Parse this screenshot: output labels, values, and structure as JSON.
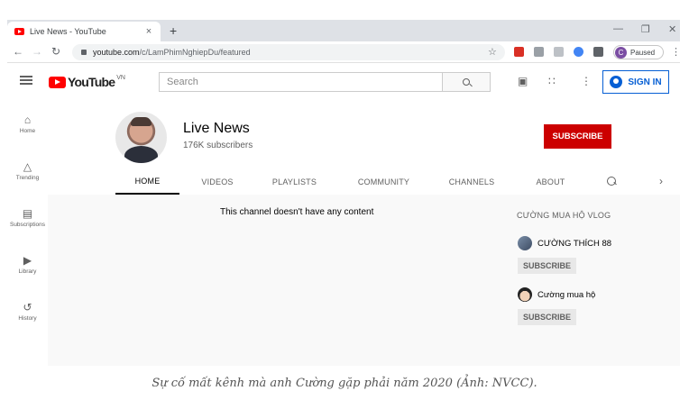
{
  "browser": {
    "tab_title": "Live News - YouTube",
    "tab_close": "×",
    "new_tab": "+",
    "url_host": "youtube.com",
    "url_path": "/c/LamPhimNghiepDu/featured",
    "profile_initial": "C",
    "profile_status": "Paused"
  },
  "header": {
    "logo_text": "YouTube",
    "logo_country": "VN",
    "search_placeholder": "Search",
    "signin_label": "SIGN IN"
  },
  "guide": {
    "items": [
      {
        "label": "Home",
        "icon": "home-icon"
      },
      {
        "label": "Trending",
        "icon": "flame-icon"
      },
      {
        "label": "Subscriptions",
        "icon": "subscriptions-icon"
      },
      {
        "label": "Library",
        "icon": "library-icon"
      },
      {
        "label": "History",
        "icon": "history-icon"
      }
    ]
  },
  "channel": {
    "name": "Live News",
    "subscribers": "176K subscribers",
    "subscribe_label": "SUBSCRIBE",
    "tabs": [
      {
        "label": "HOME"
      },
      {
        "label": "VIDEOS"
      },
      {
        "label": "PLAYLISTS"
      },
      {
        "label": "COMMUNITY"
      },
      {
        "label": "CHANNELS"
      },
      {
        "label": "ABOUT"
      }
    ]
  },
  "content": {
    "empty_message": "This channel doesn't have any content"
  },
  "sidebar": {
    "title": "CƯỜNG MUA HỘ VLOG",
    "channels": [
      {
        "name": "CƯỜNG THÍCH 88",
        "subscribe_label": "SUBSCRIBE"
      },
      {
        "name": "Cường mua hộ",
        "subscribe_label": "SUBSCRIBE"
      }
    ]
  },
  "caption": "Sự cố mất kênh mà anh Cường gặp phải năm 2020 (Ảnh: NVCC).",
  "colors": {
    "brand_red": "#ff0000",
    "subscribe_red": "#cc0000",
    "signin_blue": "#065fd4"
  }
}
